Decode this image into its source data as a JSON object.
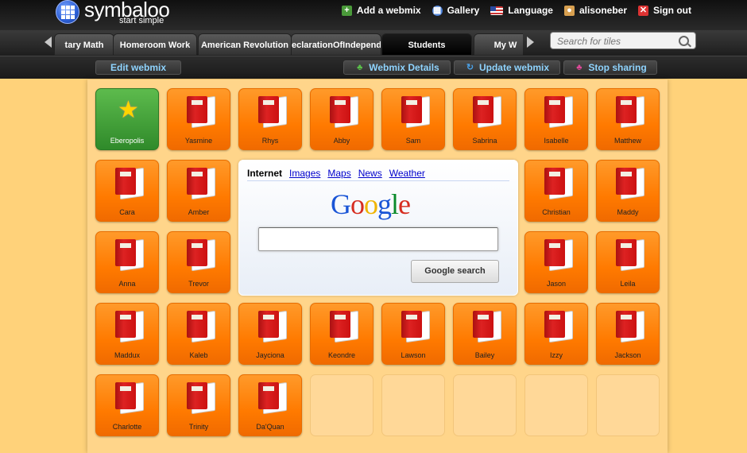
{
  "header": {
    "logo": {
      "name": "symbaloo",
      "tagline": "start simple"
    },
    "links": [
      {
        "label": "Add a webmix",
        "icon": "plus-icon",
        "color": "#4a9a3a"
      },
      {
        "label": "Gallery",
        "icon": "gallery-icon",
        "color": "#4a7fd6"
      },
      {
        "label": "Language",
        "icon": "flag-icon",
        "color": "#c33"
      },
      {
        "label": "alisoneber",
        "icon": "user-icon",
        "color": "#d8a050"
      },
      {
        "label": "Sign out",
        "icon": "sign-out-icon",
        "color": "#d33"
      }
    ]
  },
  "tabs": [
    {
      "label": "tary Math"
    },
    {
      "label": "Homeroom Work"
    },
    {
      "label": "American Revolution"
    },
    {
      "label": "eclarationOfIndepend"
    },
    {
      "label": "Students",
      "active": true
    },
    {
      "label": "My W"
    }
  ],
  "search": {
    "placeholder": "Search for tiles"
  },
  "actions": {
    "edit": "Edit webmix",
    "details": "Webmix Details",
    "update": "Update webmix",
    "stop": "Stop sharing"
  },
  "tiles": [
    {
      "label": "Eberopolis",
      "type": "green"
    },
    {
      "label": "Yasmine"
    },
    {
      "label": "Rhys"
    },
    {
      "label": "Abby"
    },
    {
      "label": "Sam"
    },
    {
      "label": "Sabrina"
    },
    {
      "label": "Isabelle"
    },
    {
      "label": "Matthew"
    },
    {
      "label": "Cara"
    },
    {
      "label": "Amber"
    },
    {
      "label": "Christian"
    },
    {
      "label": "Maddy"
    },
    {
      "label": "Anna"
    },
    {
      "label": "Trevor"
    },
    {
      "label": "Jason"
    },
    {
      "label": "Leila"
    },
    {
      "label": "Maddux"
    },
    {
      "label": "Kaleb"
    },
    {
      "label": "Jayciona"
    },
    {
      "label": "Keondre"
    },
    {
      "label": "Lawson"
    },
    {
      "label": "Bailey"
    },
    {
      "label": "Izzy"
    },
    {
      "label": "Jackson"
    },
    {
      "label": "Charlotte"
    },
    {
      "label": "Trinity"
    },
    {
      "label": "Da'Quan"
    }
  ],
  "google": {
    "tabs": [
      "Internet",
      "Images",
      "Maps",
      "News",
      "Weather"
    ],
    "logo": "Google",
    "button": "Google search",
    "query": ""
  }
}
